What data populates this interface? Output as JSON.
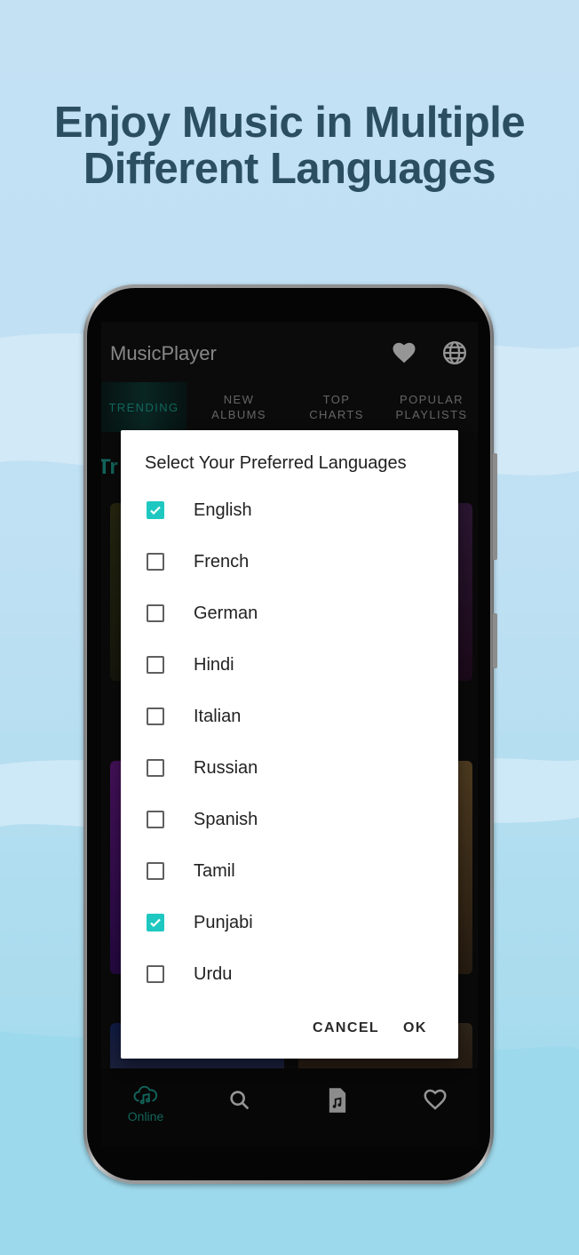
{
  "headline": {
    "line1": "Enjoy Music in Multiple",
    "line2": "Different Languages"
  },
  "app": {
    "title": "MusicPlayer",
    "icons": [
      "heart-icon",
      "globe-icon"
    ],
    "tabs": [
      {
        "line1": "TRENDING",
        "line2": ""
      },
      {
        "line1": "NEW",
        "line2": "ALBUMS"
      },
      {
        "line1": "TOP",
        "line2": "CHARTS"
      },
      {
        "line1": "POPULAR",
        "line2": "PLAYLISTS"
      }
    ],
    "section_peek": "Tr",
    "bottom_nav": {
      "online_label": "Online"
    }
  },
  "dialog": {
    "title": "Select Your Preferred Languages",
    "options": [
      {
        "label": "English",
        "checked": true
      },
      {
        "label": "French",
        "checked": false
      },
      {
        "label": "German",
        "checked": false
      },
      {
        "label": "Hindi",
        "checked": false
      },
      {
        "label": "Italian",
        "checked": false
      },
      {
        "label": "Russian",
        "checked": false
      },
      {
        "label": "Spanish",
        "checked": false
      },
      {
        "label": "Tamil",
        "checked": false
      },
      {
        "label": "Punjabi",
        "checked": true
      },
      {
        "label": "Urdu",
        "checked": false
      }
    ],
    "cancel_label": "CANCEL",
    "ok_label": "OK"
  },
  "colors": {
    "accent": "#1ec8c0",
    "headline": "#2b4f61",
    "tab_active": "#1c9c8c"
  }
}
